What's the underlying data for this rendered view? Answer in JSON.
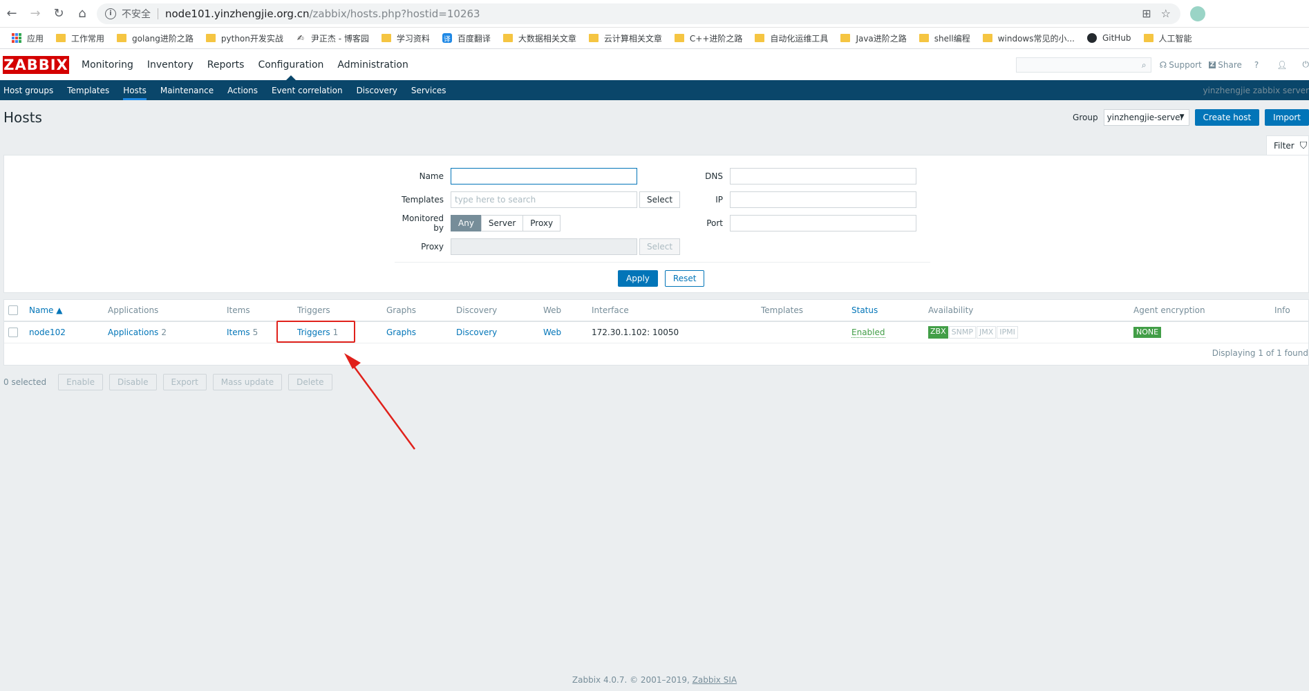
{
  "browser": {
    "insecure_label": "不安全",
    "url_host": "node101.yinzhengjie.org.cn",
    "url_path": "/zabbix/hosts.php?hostid=10263"
  },
  "bookmarks": [
    "应用",
    "工作常用",
    "golang进阶之路",
    "python开发实战",
    "尹正杰 - 博客园",
    "学习资料",
    "百度翻译",
    "大数据相关文章",
    "云计算相关文章",
    "C++进阶之路",
    "自动化运维工具",
    "Java进阶之路",
    "shell编程",
    "windows常见的小...",
    "GitHub",
    "人工智能"
  ],
  "header": {
    "logo": "ZABBIX",
    "menu": [
      "Monitoring",
      "Inventory",
      "Reports",
      "Configuration",
      "Administration"
    ],
    "active_menu": "Configuration",
    "support": "Support",
    "share": "Share",
    "help": "?"
  },
  "submenu": {
    "items": [
      "Host groups",
      "Templates",
      "Hosts",
      "Maintenance",
      "Actions",
      "Event correlation",
      "Discovery",
      "Services"
    ],
    "active": "Hosts",
    "server_name": "yinzhengjie zabbix server"
  },
  "page": {
    "title": "Hosts",
    "group_label": "Group",
    "group_value": "yinzhengjie-server",
    "create_host": "Create host",
    "import": "Import"
  },
  "filter": {
    "tab_label": "Filter",
    "name_label": "Name",
    "templates_label": "Templates",
    "templates_placeholder": "type here to search",
    "select_label": "Select",
    "monitored_by_label": "Monitored by",
    "monitored_options": [
      "Any",
      "Server",
      "Proxy"
    ],
    "proxy_label": "Proxy",
    "dns_label": "DNS",
    "ip_label": "IP",
    "port_label": "Port",
    "apply": "Apply",
    "reset": "Reset"
  },
  "table": {
    "headers": [
      "Name ▲",
      "Applications",
      "Items",
      "Triggers",
      "Graphs",
      "Discovery",
      "Web",
      "Interface",
      "Templates",
      "Status",
      "Availability",
      "Agent encryption",
      "Info"
    ],
    "row": {
      "name": "node102",
      "applications": "Applications",
      "applications_count": "2",
      "items": "Items",
      "items_count": "5",
      "triggers": "Triggers",
      "triggers_count": "1",
      "graphs": "Graphs",
      "discovery": "Discovery",
      "web": "Web",
      "interface": "172.30.1.102: 10050",
      "status": "Enabled",
      "availability": [
        "ZBX",
        "SNMP",
        "JMX",
        "IPMI"
      ],
      "encryption": "NONE"
    },
    "displaying": "Displaying 1 of 1 found"
  },
  "actions": {
    "selected": "0 selected",
    "buttons": [
      "Enable",
      "Disable",
      "Export",
      "Mass update",
      "Delete"
    ]
  },
  "footer": {
    "text": "Zabbix 4.0.7. © 2001–2019,",
    "company": "Zabbix SIA"
  },
  "colors": {
    "nav_bg": "#0a466a",
    "accent": "#0275b8",
    "logo_red": "#d40000",
    "annotation_red": "#e0211b",
    "ok_green": "#429e47"
  }
}
